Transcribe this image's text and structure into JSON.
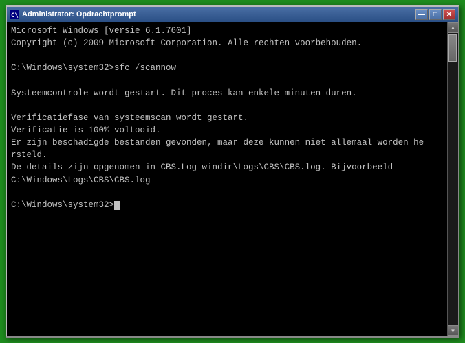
{
  "window": {
    "title": "Administrator: Opdrachtprompt",
    "icon_label": "C:\\",
    "buttons": {
      "minimize": "—",
      "maximize": "□",
      "close": "✕"
    }
  },
  "terminal": {
    "lines": [
      "Microsoft Windows [versie 6.1.7601]",
      "Copyright (c) 2009 Microsoft Corporation. Alle rechten voorbehouden.",
      "",
      "C:\\Windows\\system32>sfc /scannow",
      "",
      "Systeemcontrole wordt gestart. Dit proces kan enkele minuten duren.",
      "",
      "Verificatiefase van systeemscan wordt gestart.",
      "Verificatie is 100% voltooid.",
      "Er zijn beschadigde bestanden gevonden, maar deze kunnen niet allemaal worden he",
      "rsteld.",
      "De details zijn opgenomen in CBS.Log windir\\Logs\\CBS\\CBS.log. Bijvoorbeeld",
      "C:\\Windows\\Logs\\CBS\\CBS.log",
      "",
      "C:\\Windows\\system32>"
    ]
  },
  "scrollbar": {
    "up_arrow": "▲",
    "down_arrow": "▼"
  }
}
